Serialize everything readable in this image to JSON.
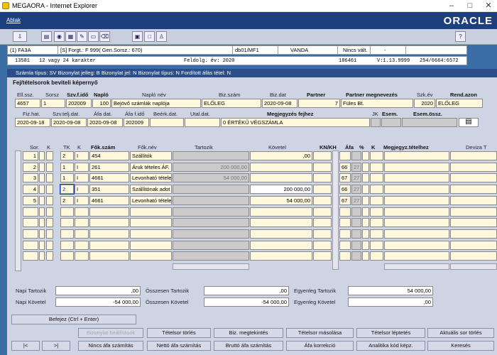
{
  "window": {
    "title": "MEGAORA - Internet Explorer",
    "min": "–",
    "max": "□",
    "close": "✕"
  },
  "menu": {
    "item": "Ablak",
    "brand": "ORACLE"
  },
  "status1": {
    "c1": "(1) FA3A",
    "c2": "[S] Forgt.: F 999( Gen.Sorsz.: 670)",
    "c3": "db01/MF1",
    "c4": "VANDA",
    "c5": "Nincs vált.",
    "c6": "-"
  },
  "status2": {
    "c1": "13581",
    "c2": "12 vagy 24 karakter",
    "c3": "Feldolg. év: 2020",
    "c4": "186461",
    "c5": "V:1.13.9999",
    "c6": "254/6664:6572"
  },
  "form_title": "Számla típus: SV Bizonylat jelleg: B Bizonylat jel: N Bizonylat típus: N Fordított áfás tétel: N",
  "section": "Fej/tételsorok beviteli képernyő",
  "header1": {
    "labels": {
      "ell": "Ell.ssz.",
      "sorsz": "Sorsz",
      "szvfido": "Szv.f.idő",
      "naplo": "Napló",
      "naplonev": "Napló név",
      "bizszam": "Biz.szám",
      "bizdat": "Biz.dat",
      "partner": "Partner",
      "partnernev": "Partner megnevezés",
      "szkev": "Szk.év",
      "rendazon": "Rend.azon"
    },
    "values": {
      "ell": "4657",
      "sorsz": "1",
      "szvfido": "202009",
      "naplo": "100",
      "naplonev": "Bejövő számlák naplója",
      "bizszam": "ELŐLEG",
      "bizdat": "2020-09-08",
      "partner": "7",
      "partnernev": "Füles Bt.",
      "szkev": "2020",
      "rendazon": "ELŐLEG"
    }
  },
  "header2": {
    "labels": {
      "fizhat": "Fiz.hat.",
      "szvtelj": "Szv.telj.dat.",
      "afadat": "Áfa dat.",
      "afafido": "Áfa f.idő",
      "beerk": "Beérk.dat.",
      "utal": "Utal.dat.",
      "megj": "Megjegyzés fejhez",
      "jk": "JK",
      "esem": "Esem.",
      "esemossz": "Esem.össz."
    },
    "values": {
      "fizhat": "2020-09-18",
      "szvtelj": "2020-09-08",
      "afadat": "2020-09-08",
      "afafido": "202009",
      "beerk": "",
      "utal": "",
      "megj": "0 ÉRTÉKŰ VÉGSZÁMLA"
    }
  },
  "grid": {
    "headers": {
      "sor": "Sor.",
      "k": "K",
      "tk": "TK",
      "k2": "K",
      "fokszam": "Fők.szám",
      "foknev": "Fők.név",
      "tartozik": "Tartozik",
      "kovetel": "Követel",
      "knkh": "KN/KH",
      "afa": "Áfa",
      "pct": "%",
      "k3": "K",
      "megj": "Megjegyz.tételhez",
      "deviza": "Deviza T"
    },
    "rows": [
      {
        "n": "1",
        "tk": "2",
        "k": "I",
        "szam": "454",
        "nev": "Szállítók",
        "tart": "",
        "kov": ",00",
        "afa": "",
        "pct": ""
      },
      {
        "n": "2",
        "tk": "1",
        "k": "I",
        "szam": "261",
        "nev": "Áruk tételes ÁF.",
        "tart": "200 000,00",
        "kov": "",
        "afa": "66",
        "pct": "27"
      },
      {
        "n": "3",
        "tk": "1",
        "k": "I",
        "szam": "4661",
        "nev": "Levonható tétele",
        "tart": "54 000,00",
        "kov": "",
        "afa": "67",
        "pct": "27"
      },
      {
        "n": "4",
        "tk": "2",
        "k": "I",
        "szam": "351",
        "nev": "Szállítónak adot",
        "tart": "",
        "kov": "200 000,00",
        "afa": "66",
        "pct": "27"
      },
      {
        "n": "5",
        "tk": "2",
        "k": "I",
        "szam": "4661",
        "nev": "Levonható tétele",
        "tart": "",
        "kov": "54 000,00",
        "afa": "67",
        "pct": "27"
      }
    ]
  },
  "totals": {
    "napi_tart_l": "Napi Tartozik",
    "napi_tart": ",00",
    "ossz_tart_l": "Összesen Tartozik",
    "ossz_tart": ",00",
    "egy_tart_l": "Egyenleg Tartozik",
    "egy_tart": "54 000,00",
    "napi_kov_l": "Napi Követel",
    "napi_kov": "-54 000,00",
    "ossz_kov_l": "Összesen Követel",
    "ossz_kov": "-54 000,00",
    "egy_kov_l": "Egyenleg Követel",
    "egy_kov": ",00"
  },
  "buttons": {
    "befejez": "Befejez (Ctrl + Enter)",
    "row1": [
      "Bizonylat beállítások",
      "Tételsor törlés",
      "Biz. megtekintés",
      "Tételsor másolása",
      "Tételsor léptetés",
      "Aktuális sor törlés"
    ],
    "row2": [
      "|<",
      ">|",
      "Nincs áfa számítás",
      "Nettó áfa számítás",
      "Bruttó áfa számítás",
      "Áfa korrekció",
      "Analitika kód képz.",
      "Keresés"
    ]
  }
}
